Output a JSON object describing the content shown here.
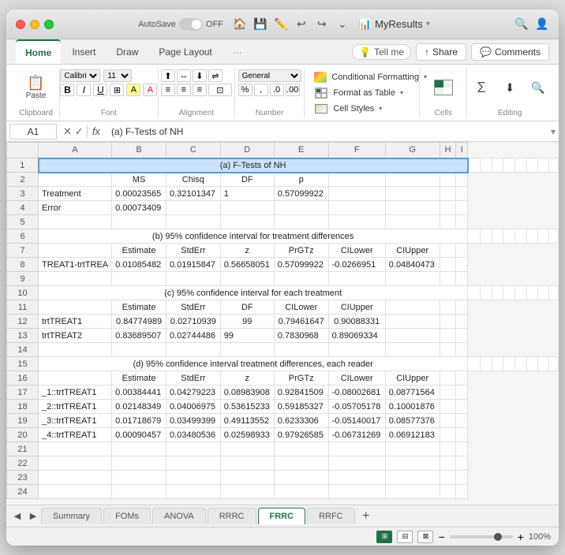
{
  "window": {
    "title": "MyResults",
    "traffic_lights": [
      "close",
      "minimize",
      "maximize"
    ],
    "autosave_label": "AutoSave",
    "autosave_state": "OFF"
  },
  "ribbon_tabs": {
    "tabs": [
      "Home",
      "Insert",
      "Draw",
      "Page Layout",
      "Tell me"
    ],
    "active_tab": "Home",
    "right_buttons": [
      "Share",
      "Comments"
    ]
  },
  "toolbar": {
    "groups": [
      {
        "name": "Clipboard",
        "label": "Clipboard"
      },
      {
        "name": "Font",
        "label": "Font"
      },
      {
        "name": "Alignment",
        "label": "Alignment"
      },
      {
        "name": "Number",
        "label": "Number"
      },
      {
        "name": "Styles",
        "items": [
          "Conditional Formatting",
          "Format as Table",
          "Cell Styles"
        ]
      },
      {
        "name": "Cells",
        "label": "Cells"
      },
      {
        "name": "Editing",
        "label": "Editing"
      }
    ]
  },
  "formula_bar": {
    "cell_ref": "A1",
    "formula": "(a) F-Tests of NH"
  },
  "spreadsheet": {
    "col_headers": [
      "",
      "A",
      "B",
      "C",
      "D",
      "E",
      "F",
      "G",
      "H",
      "I"
    ],
    "rows": [
      {
        "row_num": "1",
        "cells": [
          "(a) F-Tests of NH",
          "",
          "",
          "",
          "",
          "",
          "",
          "",
          ""
        ]
      },
      {
        "row_num": "2",
        "cells": [
          "",
          "MS",
          "Chisq",
          "DF",
          "p",
          "",
          "",
          "",
          ""
        ]
      },
      {
        "row_num": "3",
        "cells": [
          "Treatment",
          "0.00023565",
          "0.32101347",
          "1",
          "0.57099922",
          "",
          "",
          "",
          ""
        ]
      },
      {
        "row_num": "4",
        "cells": [
          "Error",
          "0.00073409",
          "",
          "",
          "",
          "",
          "",
          "",
          ""
        ]
      },
      {
        "row_num": "5",
        "cells": [
          "",
          "",
          "",
          "",
          "",
          "",
          "",
          "",
          ""
        ]
      },
      {
        "row_num": "6",
        "cells": [
          "(b) 95% confidence interval for treatment differences",
          "",
          "",
          "",
          "",
          "",
          "",
          "",
          ""
        ]
      },
      {
        "row_num": "7",
        "cells": [
          "",
          "Estimate",
          "StdErr",
          "z",
          "PrGTz",
          "CILower",
          "CIUpper",
          "",
          ""
        ]
      },
      {
        "row_num": "8",
        "cells": [
          "TREAT1-trtTREA",
          "0.01085482",
          "0.01915847",
          "0.56658051",
          "0.57099922",
          "-0.0266951",
          "0.04840473",
          "",
          ""
        ]
      },
      {
        "row_num": "9",
        "cells": [
          "",
          "",
          "",
          "",
          "",
          "",
          "",
          "",
          ""
        ]
      },
      {
        "row_num": "10",
        "cells": [
          "(c) 95% confidence interval for each treatment",
          "",
          "",
          "",
          "",
          "",
          "",
          "",
          ""
        ]
      },
      {
        "row_num": "11",
        "cells": [
          "",
          "Estimate",
          "StdErr",
          "DF",
          "CILower",
          "CIUpper",
          "",
          "",
          ""
        ]
      },
      {
        "row_num": "12",
        "cells": [
          "trtTREAT1",
          "0.84774989",
          "0.02710939",
          "99",
          "0.79461647",
          "0.90088331",
          "",
          "",
          ""
        ]
      },
      {
        "row_num": "13",
        "cells": [
          "trtTREAT2",
          "0.83689507",
          "0.02744486",
          "99",
          "0.7830968",
          "0.89069334",
          "",
          "",
          ""
        ]
      },
      {
        "row_num": "14",
        "cells": [
          "",
          "",
          "",
          "",
          "",
          "",
          "",
          "",
          ""
        ]
      },
      {
        "row_num": "15",
        "cells": [
          "(d) 95% confidence interval treatment differences, each reader",
          "",
          "",
          "",
          "",
          "",
          "",
          "",
          ""
        ]
      },
      {
        "row_num": "16",
        "cells": [
          "",
          "Estimate",
          "StdErr",
          "z",
          "PrGTz",
          "CILower",
          "CIUpper",
          "",
          ""
        ]
      },
      {
        "row_num": "17",
        "cells": [
          "_1::trtTREAT1",
          "0.00384441",
          "0.04279223",
          "0.08983908",
          "0.92841509",
          "-0.08002681",
          "0.08771564",
          "",
          ""
        ]
      },
      {
        "row_num": "18",
        "cells": [
          "_2::trtTREAT1",
          "0.02148349",
          "0.04006975",
          "0.53615233",
          "0.59185327",
          "-0.05705178",
          "0.10001876",
          "",
          ""
        ]
      },
      {
        "row_num": "19",
        "cells": [
          "_3::trtTREAT1",
          "0.01718679",
          "0.03499399",
          "0.49113552",
          "0.6233306",
          "-0.05140017",
          "0.08577376",
          "",
          ""
        ]
      },
      {
        "row_num": "20",
        "cells": [
          "_4::trtTREAT1",
          "0.00090457",
          "0.03480536",
          "0.02598933",
          "0.97926585",
          "-0.06731269",
          "0.06912183",
          "",
          ""
        ]
      },
      {
        "row_num": "21",
        "cells": [
          "",
          "",
          "",
          "",
          "",
          "",
          "",
          "",
          ""
        ]
      },
      {
        "row_num": "22",
        "cells": [
          "",
          "",
          "",
          "",
          "",
          "",
          "",
          "",
          ""
        ]
      },
      {
        "row_num": "23",
        "cells": [
          "",
          "",
          "",
          "",
          "",
          "",
          "",
          "",
          ""
        ]
      },
      {
        "row_num": "24",
        "cells": [
          "",
          "",
          "",
          "",
          "",
          "",
          "",
          "",
          ""
        ]
      }
    ]
  },
  "sheet_tabs": {
    "tabs": [
      "Summary",
      "FOMs",
      "ANOVA",
      "RRRC",
      "FRRC",
      "RRFC"
    ],
    "active_tab": "FRRC"
  },
  "status_bar": {
    "zoom": "100%",
    "views": [
      "normal",
      "page_layout",
      "page_break"
    ]
  }
}
